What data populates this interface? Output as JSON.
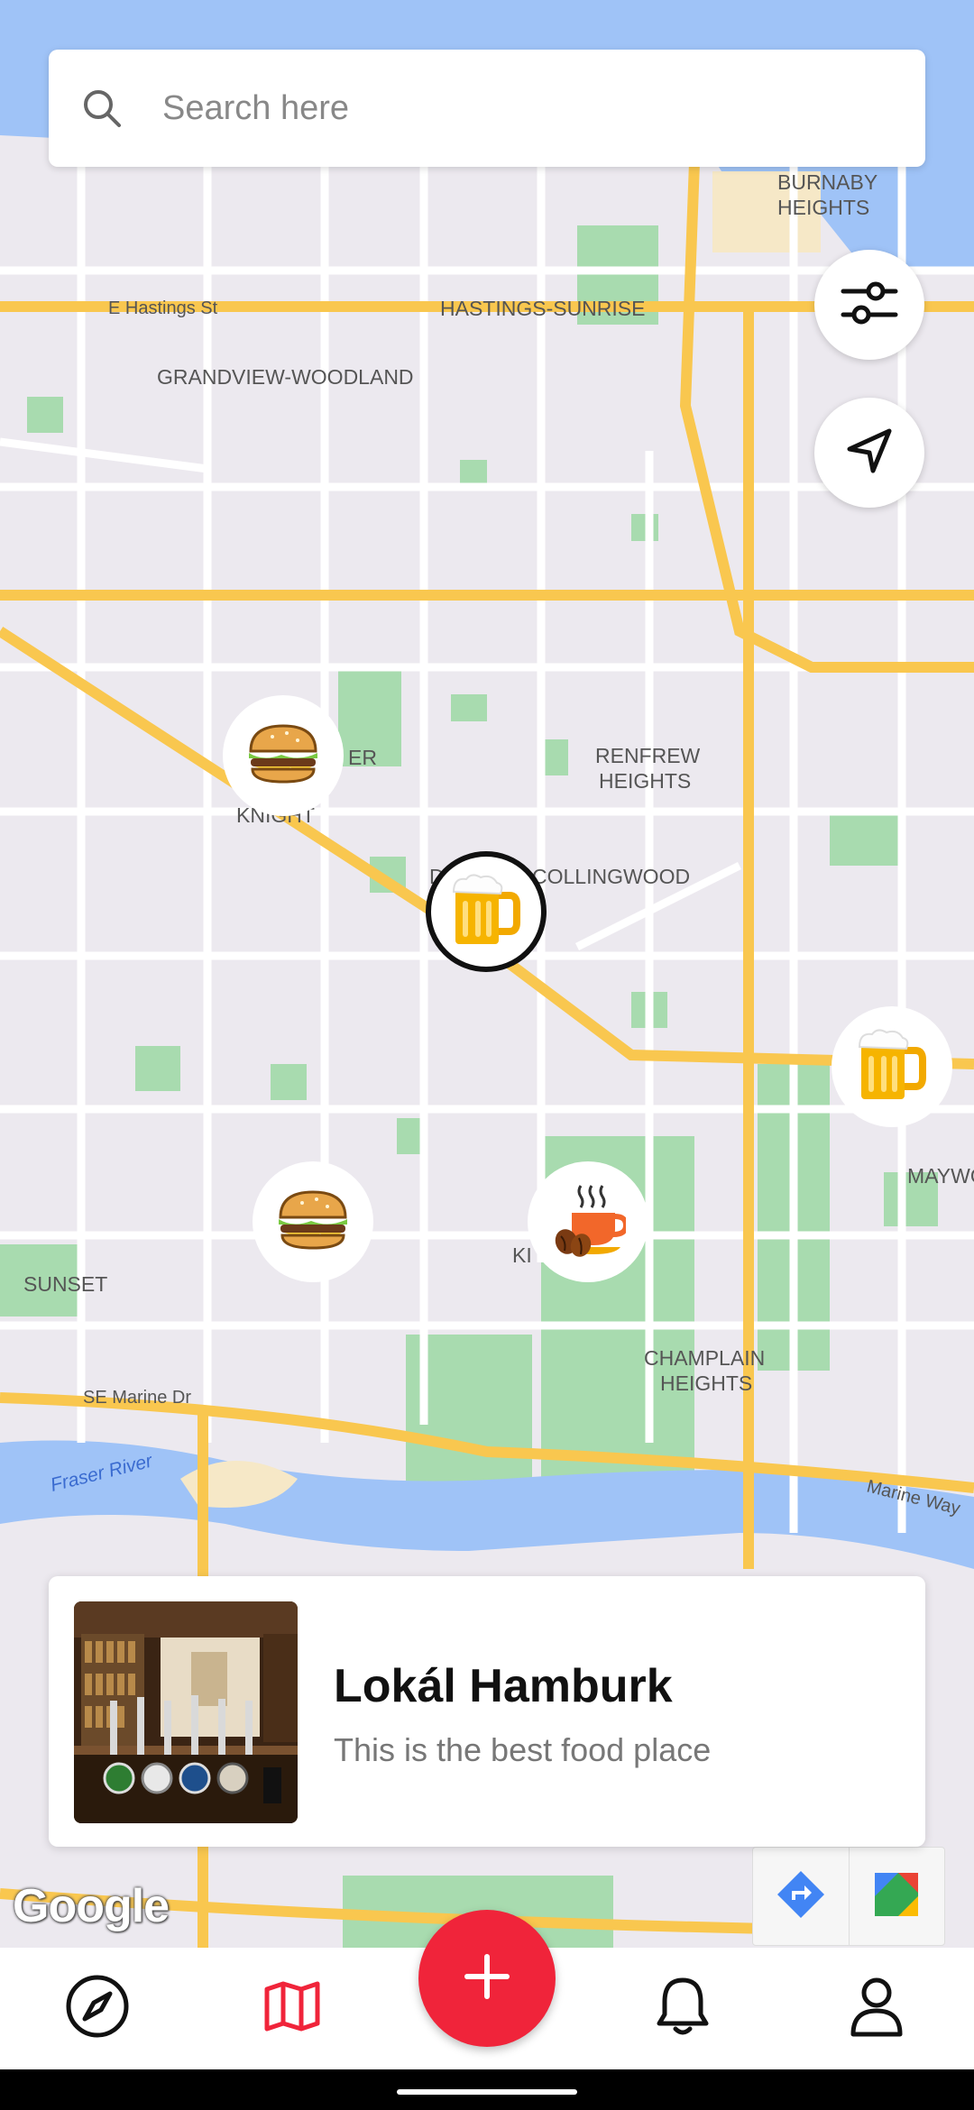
{
  "search": {
    "placeholder": "Search here"
  },
  "map": {
    "labels": {
      "burnaby_heights": "BURNABY HEIGHTS",
      "e_hastings": "E Hastings St",
      "hastings_sunrise": "HASTINGS-SUNRISE",
      "grandview": "GRANDVIEW-WOODLAND",
      "er_fragment": "ER",
      "renfrew": "RENFREW HEIGHTS",
      "knight": "KNIGHT",
      "collingwood": "COLLINGWOOD",
      "d_fragment": "D",
      "maywood": "MAYWO",
      "sunset": "SUNSET",
      "ki_fragment": "KI",
      "champlain": "CHAMPLAIN HEIGHTS",
      "se_marine": "SE Marine Dr",
      "fraser_river": "Fraser River",
      "marine_way": "Marine Way"
    },
    "markers": [
      "burger",
      "beer",
      "beer",
      "burger",
      "coffee"
    ],
    "selected_marker": "beer",
    "google_logo": "Google"
  },
  "place_card": {
    "title": "Lokál Hamburk",
    "description": "This is the best food place"
  },
  "nav": {
    "items": [
      "explore-icon",
      "map-icon",
      "add-icon",
      "notifications-icon",
      "profile-icon"
    ],
    "active": "map-icon"
  },
  "colors": {
    "accent": "#f0243a",
    "road_major": "#f9c74f",
    "water": "#9fc3f7",
    "park": "#a8dbaf",
    "land": "#ece9ef"
  }
}
